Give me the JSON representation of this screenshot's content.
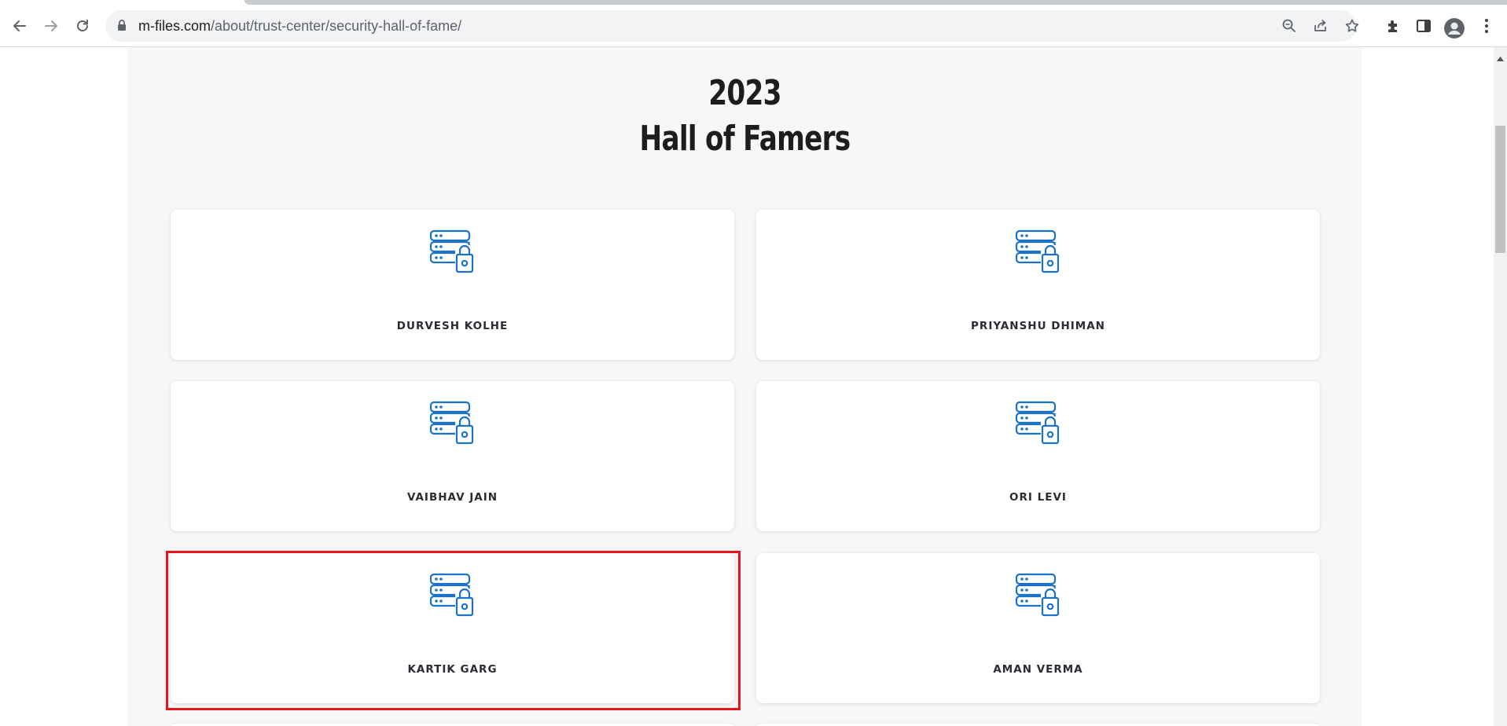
{
  "browser": {
    "url_host": "m-files.com",
    "url_path": "/about/trust-center/security-hall-of-fame/"
  },
  "page": {
    "year": "2023",
    "title": "Hall of Famers",
    "cards": [
      {
        "name": "DURVESH KOLHE",
        "icon": "server-lock-icon"
      },
      {
        "name": "PRIYANSHU DHIMAN",
        "icon": "server-lock-icon"
      },
      {
        "name": "VAIBHAV JAIN",
        "icon": "server-lock-icon"
      },
      {
        "name": "ORI LEVI",
        "icon": "server-lock-icon"
      },
      {
        "name": "KARTIK GARG",
        "icon": "server-lock-icon"
      },
      {
        "name": "AMAN VERMA",
        "icon": "server-lock-icon"
      }
    ],
    "highlighted_card": "KARTIK GARG"
  },
  "colors": {
    "icon_blue": "#1a73c8",
    "highlight_red": "#e8141c",
    "panel_bg": "#f7f7f7"
  }
}
